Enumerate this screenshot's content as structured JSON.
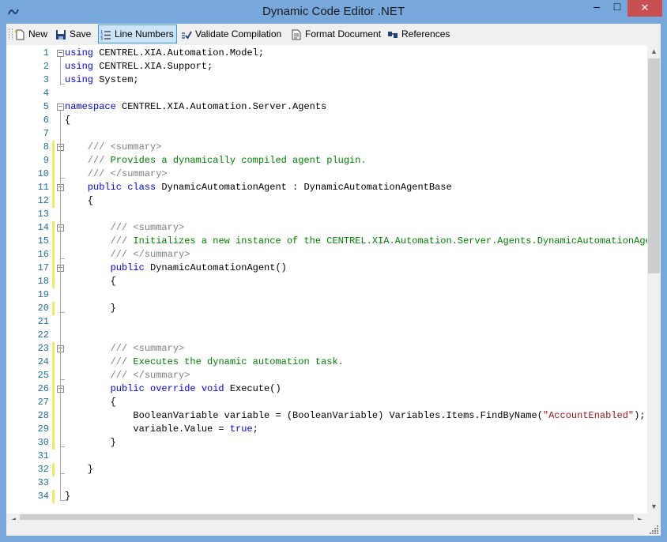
{
  "window": {
    "title": "Dynamic Code Editor .NET"
  },
  "titlebar_buttons": {
    "minimize": "‒",
    "maximize": "□",
    "close": "✕"
  },
  "toolbar": {
    "new_label": "New",
    "save_label": "Save",
    "line_numbers_label": "Line Numbers",
    "validate_label": "Validate Compilation",
    "format_label": "Format Document",
    "references_label": "References"
  },
  "colors": {
    "keyword": "#0000ff",
    "comment": "#808080",
    "comment_text": "#008000",
    "string": "#a31515",
    "line_number": "#1d6fa8",
    "change_marker": "#f0ea5a"
  },
  "editor": {
    "line_numbers": [
      "1",
      "2",
      "3",
      "4",
      "5",
      "6",
      "7",
      "8",
      "9",
      "10",
      "11",
      "12",
      "13",
      "14",
      "15",
      "16",
      "17",
      "18",
      "19",
      "20",
      "21",
      "22",
      "23",
      "24",
      "25",
      "26",
      "27",
      "28",
      "29",
      "30",
      "31",
      "32",
      "33",
      "34"
    ],
    "lines": [
      [
        {
          "t": "kw",
          "v": "using"
        },
        {
          "t": "",
          "v": " CENTREL.XIA.Automation.Model;"
        }
      ],
      [
        {
          "t": "kw",
          "v": "using"
        },
        {
          "t": "",
          "v": " CENTREL.XIA.Support;"
        }
      ],
      [
        {
          "t": "kw",
          "v": "using"
        },
        {
          "t": "",
          "v": " System;"
        }
      ],
      [],
      [
        {
          "t": "kw",
          "v": "namespace"
        },
        {
          "t": "",
          "v": " CENTREL.XIA.Automation.Server.Agents"
        }
      ],
      [
        {
          "t": "",
          "v": "{"
        }
      ],
      [],
      [
        {
          "t": "cm",
          "v": "    /// <summary>"
        }
      ],
      [
        {
          "t": "cm",
          "v": "    /// "
        },
        {
          "t": "cg",
          "v": "Provides a dynamically compiled agent plugin."
        }
      ],
      [
        {
          "t": "cm",
          "v": "    /// </summary>"
        }
      ],
      [
        {
          "t": "kw",
          "v": "    public class"
        },
        {
          "t": "",
          "v": " DynamicAutomationAgent : DynamicAutomationAgentBase"
        }
      ],
      [
        {
          "t": "",
          "v": "    {"
        }
      ],
      [],
      [
        {
          "t": "cm",
          "v": "        /// <summary>"
        }
      ],
      [
        {
          "t": "cm",
          "v": "        /// "
        },
        {
          "t": "cg",
          "v": "Initializes a new instance of the CENTREL.XIA.Automation.Server.Agents.DynamicAutomationAgent"
        }
      ],
      [
        {
          "t": "cm",
          "v": "        /// </summary>"
        }
      ],
      [
        {
          "t": "kw",
          "v": "        public"
        },
        {
          "t": "",
          "v": " DynamicAutomationAgent()"
        }
      ],
      [
        {
          "t": "",
          "v": "        {"
        }
      ],
      [],
      [
        {
          "t": "",
          "v": "        }"
        }
      ],
      [],
      [],
      [
        {
          "t": "cm",
          "v": "        /// <summary>"
        }
      ],
      [
        {
          "t": "cm",
          "v": "        /// "
        },
        {
          "t": "cg",
          "v": "Executes the dynamic automation task."
        }
      ],
      [
        {
          "t": "cm",
          "v": "        /// </summary>"
        }
      ],
      [
        {
          "t": "kw",
          "v": "        public override void"
        },
        {
          "t": "",
          "v": " Execute()"
        }
      ],
      [
        {
          "t": "",
          "v": "        {"
        }
      ],
      [
        {
          "t": "",
          "v": "            BooleanVariable variable = (BooleanVariable) Variables.Items.FindByName("
        },
        {
          "t": "st",
          "v": "\"AccountEnabled\""
        },
        {
          "t": "",
          "v": ");"
        }
      ],
      [
        {
          "t": "",
          "v": "            variable.Value = "
        },
        {
          "t": "kw",
          "v": "true"
        },
        {
          "t": "",
          "v": ";"
        }
      ],
      [
        {
          "t": "",
          "v": "        }"
        }
      ],
      [],
      [
        {
          "t": "",
          "v": "    }"
        }
      ],
      [],
      [
        {
          "t": "",
          "v": "}"
        }
      ]
    ],
    "changed_lines": [
      8,
      9,
      10,
      11,
      12,
      14,
      15,
      16,
      17,
      18,
      20,
      23,
      24,
      25,
      26,
      27,
      28,
      29,
      30,
      32,
      34
    ],
    "fold_starts": [
      1,
      5,
      8,
      11,
      14,
      17,
      23,
      26
    ]
  }
}
